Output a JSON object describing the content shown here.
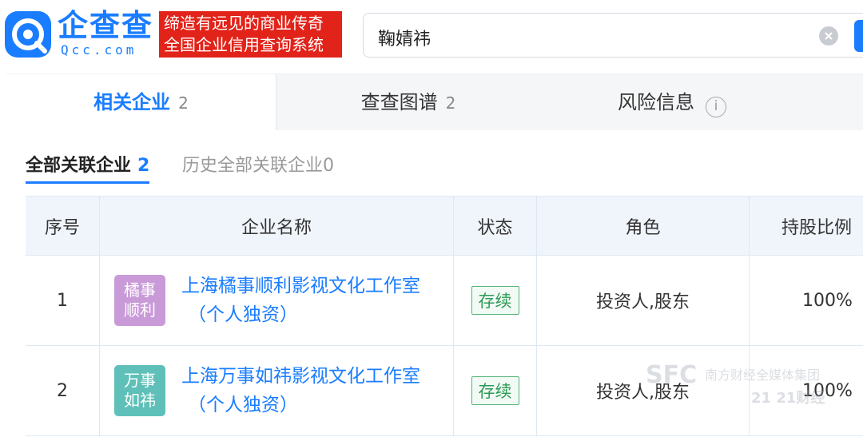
{
  "header": {
    "logo_cn": "企查查",
    "logo_en": "Qcc.com",
    "slogan_line1": "缔造有远见的商业传奇",
    "slogan_line2": "全国企业信用查询系统",
    "search_value": "鞠婧祎"
  },
  "tabs": [
    {
      "label": "相关企业",
      "count": "2"
    },
    {
      "label": "查查图谱",
      "count": "2"
    },
    {
      "label": "风险信息",
      "info": "i"
    }
  ],
  "subtabs": {
    "active_label": "全部关联企业",
    "active_count": "2",
    "history_label": "历史全部关联企业0"
  },
  "table": {
    "headers": [
      "序号",
      "企业名称",
      "状态",
      "角色",
      "持股比例"
    ],
    "rows": [
      {
        "index": "1",
        "avatar_line1": "橘事",
        "avatar_line2": "顺利",
        "name_line1": "上海橘事顺利影视文化工作室",
        "name_line2": "（个人独资）",
        "status": "存续",
        "role": "投资人,股东",
        "share": "100%"
      },
      {
        "index": "2",
        "avatar_line1": "万事",
        "avatar_line2": "如祎",
        "name_line1": "上海万事如祎影视文化工作室",
        "name_line2": "（个人独资）",
        "status": "存续",
        "role": "投资人,股东",
        "share": "100%"
      }
    ]
  },
  "watermark": {
    "sfc": "SFC",
    "group": "南方财经全媒体集团",
    "brand": "21 21财经"
  },
  "colors": {
    "brand_blue": "#1a7dff",
    "slogan_red": "#e2231a",
    "status_green": "#2f9a57"
  }
}
